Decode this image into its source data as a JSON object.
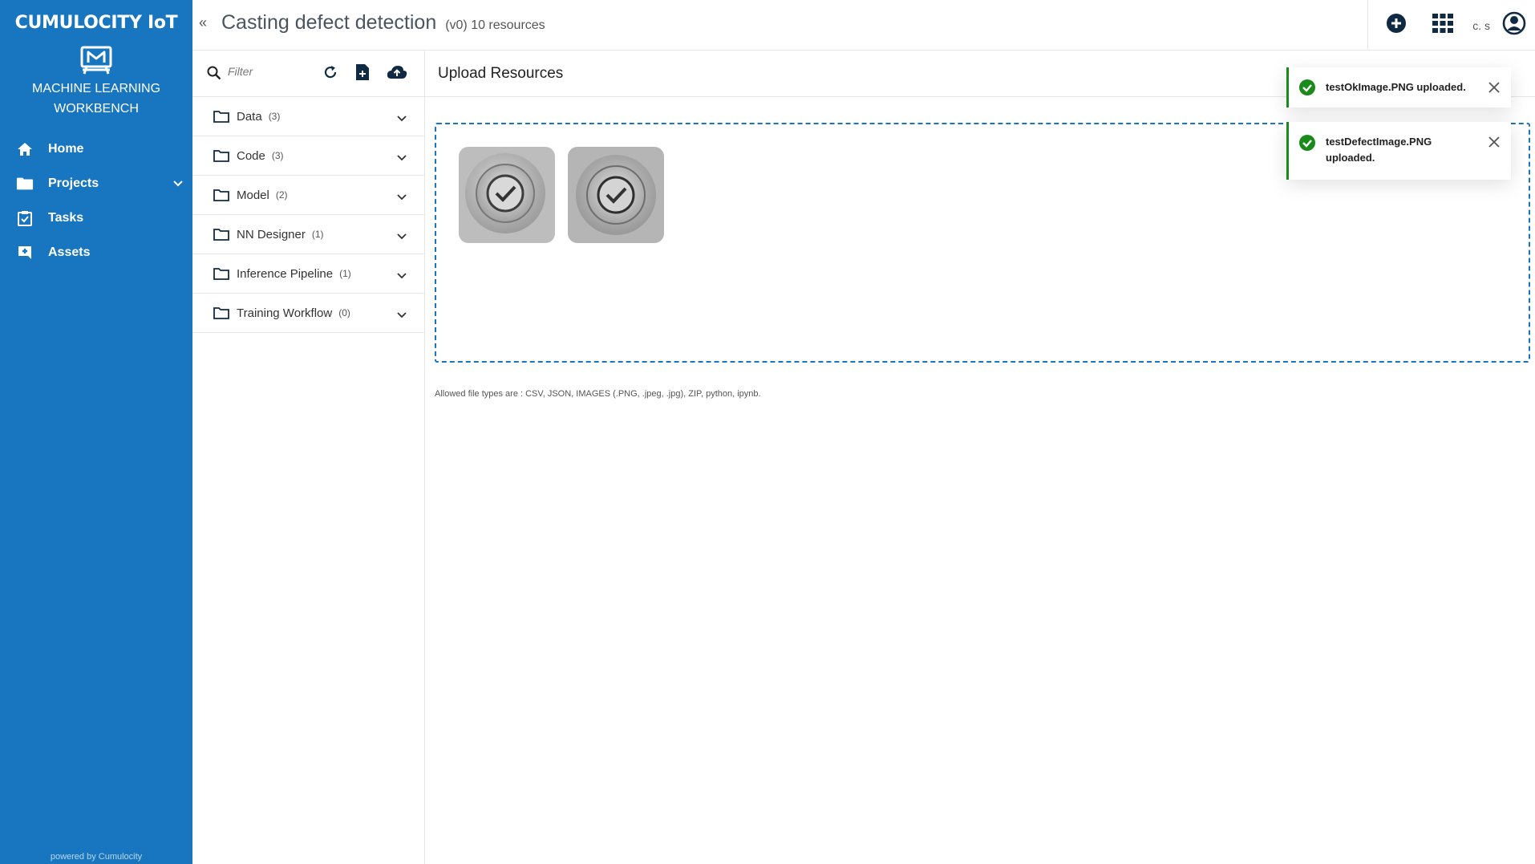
{
  "sidebar": {
    "brand": "CUMULOCITY IoT",
    "app_name_line1": "MACHINE LEARNING",
    "app_name_line2": "WORKBENCH",
    "items": [
      {
        "label": "Home",
        "icon": "home-icon"
      },
      {
        "label": "Projects",
        "icon": "folder-icon"
      },
      {
        "label": "Tasks",
        "icon": "clipboard-check-icon"
      },
      {
        "label": "Assets",
        "icon": "plus-box-icon"
      }
    ],
    "powered_by": "powered by Cumulocity",
    "bg_color": "#1776bf"
  },
  "header": {
    "collapse_glyph": "«",
    "title": "Casting defect detection",
    "subtitle": "(v0) 10 resources",
    "user_initials": "c. s"
  },
  "tree": {
    "filter_placeholder": "Filter",
    "folders": [
      {
        "label": "Data",
        "count": "(3)"
      },
      {
        "label": "Code",
        "count": "(3)"
      },
      {
        "label": "Model",
        "count": "(2)"
      },
      {
        "label": "NN Designer",
        "count": "(1)"
      },
      {
        "label": "Inference Pipeline",
        "count": "(1)"
      },
      {
        "label": "Training Workflow",
        "count": "(0)"
      }
    ]
  },
  "main": {
    "title": "Upload Resources",
    "allowed_types": "Allowed file types are : CSV, JSON, IMAGES (.PNG, .jpeg, .jpg), ZIP, python, ipynb.",
    "thumbnails": [
      {
        "name": "testOkImage.PNG"
      },
      {
        "name": "testDefectImage.PNG"
      }
    ]
  },
  "toasts": [
    {
      "text": "testOkImage.PNG uploaded."
    },
    {
      "text": "testDefectImage.PNG uploaded."
    }
  ],
  "colors": {
    "accent": "#1776bf",
    "success": "#1a8a1a"
  }
}
